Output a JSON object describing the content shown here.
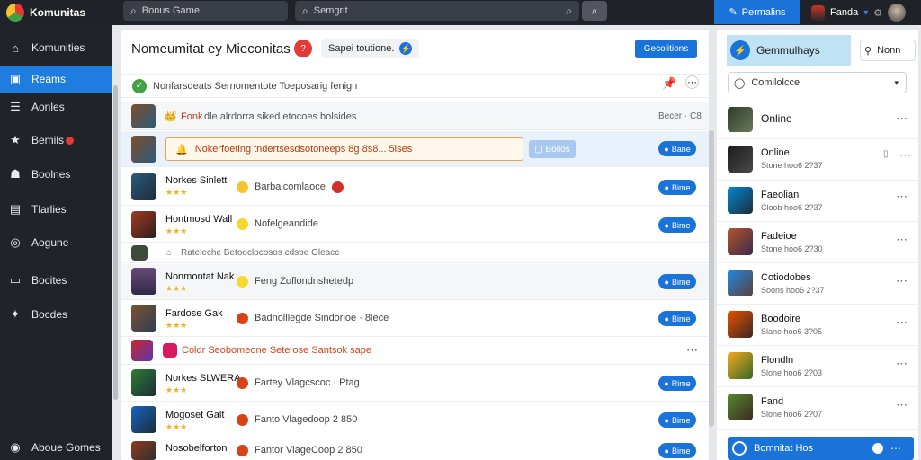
{
  "brand": {
    "name": "Komunitas"
  },
  "topbar": {
    "search_games": {
      "text": "Bonus Game"
    },
    "search_main": {
      "text": "Semgrit"
    },
    "cta": {
      "label": "Permalins"
    },
    "user": {
      "name": "Fanda"
    }
  },
  "sidebar": {
    "items": [
      {
        "label": "Komunities",
        "icon": "home-icon"
      },
      {
        "label": "Reams",
        "icon": "games-icon",
        "active": true
      },
      {
        "label": "Aonles",
        "icon": "list-icon"
      },
      {
        "label": "Bemils",
        "icon": "star-icon",
        "badge": true
      },
      {
        "label": "Boolnes",
        "icon": "people-icon"
      },
      {
        "label": "Tlarlies",
        "icon": "doc-icon"
      },
      {
        "label": "Aogune",
        "icon": "globe-icon"
      },
      {
        "label": "Bocites",
        "icon": "box-icon"
      },
      {
        "label": "Bocdes",
        "icon": "pin-icon"
      }
    ],
    "footer": {
      "label": "Aboue Gomes"
    }
  },
  "main": {
    "title": "Nomeumitat ey Mieconitas",
    "title_badge": "?",
    "pill": {
      "label": "Sapei toutione."
    },
    "header_button": "Gecolitions",
    "info": "Nonfarsdeats Sernomentote Toeposarig fenign",
    "rows": [
      {
        "name": "Fonk",
        "text": "dle alrdorra siked etocoes bolsides",
        "time": "Becer · C8"
      },
      {
        "highlight": "Nokerfoeting tndertsesdsotoneeps 8g 8s8... 5ises",
        "hl_button": "Bolios",
        "follow": "Bane"
      },
      {
        "name": "Norkes Sinlett",
        "stars": "★★★",
        "text": "Barbalcomlaoce",
        "follow": "Bime"
      },
      {
        "name": "Hontmosd Wall",
        "stars": "★★★",
        "text": "Nofelgeandide",
        "follow": "Bime"
      },
      {
        "text": "Rateleche Betooclocosos cdsbe Gleacc"
      },
      {
        "name": "Nonmontat Nak",
        "stars": "★★★",
        "text": "Feng Zoflondnshetedp",
        "follow": "Bime"
      },
      {
        "name": "Fardose Gak",
        "stars": "★★★",
        "text": "Badnolllegde Sindorioe · 8lece",
        "follow": "Bime"
      },
      {
        "text": "Coldr Seobomeone Sete ose Santsok sape"
      },
      {
        "name": "Norkes SLWERA",
        "stars": "★★★",
        "text": "Fartey Vlagcscoc · Ptag",
        "follow": "Rime"
      },
      {
        "name": "Mogoset Galt",
        "stars": "★★★",
        "text": "Fanto Vlagedoop 2 850",
        "follow": "Bime"
      },
      {
        "name": "Nosobelforton",
        "stars": "★★★",
        "text": "Fantor VlageCoop 2 850",
        "follow": "Bime"
      }
    ]
  },
  "panel": {
    "tab_active": "Gemmulhays",
    "tab_other": "Nonn",
    "select": "Comilolcce",
    "items": [
      {
        "name": "Online"
      },
      {
        "name": "Online",
        "sub": "Stone hoo6 2?37"
      },
      {
        "name": "Faeolian",
        "sub": "Cloob hoo6 2?37"
      },
      {
        "name": "Fadeioe",
        "sub": "Stone hoo6 2?30"
      },
      {
        "name": "Cotiodobes",
        "sub": "Soons hoo6 2?37"
      },
      {
        "name": "Boodoire",
        "sub": "Slane hoo6 3?05"
      },
      {
        "name": "Flondln",
        "sub": "Slone hoo6 2?03"
      },
      {
        "name": "Fand",
        "sub": "Slone hoo6 2?07"
      }
    ],
    "footer": "Bomnitat Hos"
  }
}
